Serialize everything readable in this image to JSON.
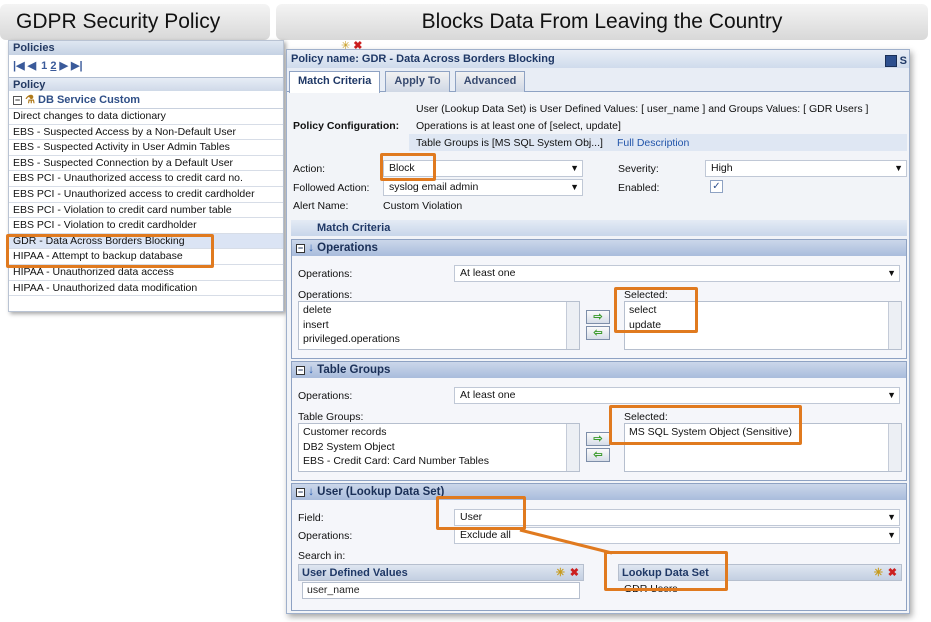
{
  "banners": {
    "left": "GDPR Security Policy",
    "right": "Blocks Data From Leaving the Country"
  },
  "left_panel": {
    "header": "Policies",
    "pager": {
      "first": "|◀",
      "prev": "◀",
      "pages": [
        "1",
        "2"
      ],
      "next": "▶",
      "last": "▶|"
    },
    "column": "Policy",
    "group": "DB Service Custom",
    "rows": [
      "Direct changes to data dictionary",
      "EBS - Suspected Access by a Non-Default User",
      "EBS - Suspected Activity in User Admin Tables",
      "EBS - Suspected Connection by a Default User",
      "EBS PCI - Unauthorized access to credit card no.",
      "EBS PCI - Unauthorized access to credit cardholder",
      "EBS PCI - Violation to credit card number table",
      "EBS PCI - Violation to credit cardholder",
      "GDR - Data Across Borders Blocking",
      "HIPAA - Attempt to backup database",
      "HIPAA - Unauthorized data access",
      "HIPAA - Unauthorized data modification"
    ]
  },
  "policy_window": {
    "title": "Policy name: GDR - Data Across Borders Blocking",
    "save_suffix": "S",
    "tabs": [
      "Match Criteria",
      "Apply To",
      "Advanced"
    ],
    "config_label": "Policy Configuration:",
    "config_lines": [
      "User (Lookup Data Set) is User Defined Values: [ user_name ] and Groups Values: [ GDR Users ]",
      "Operations is at least one of [select, update]",
      "Table Groups is [MS SQL System Obj...]"
    ],
    "full_description": "Full Description",
    "action_label": "Action:",
    "action_value": "Block",
    "severity_label": "Severity:",
    "severity_value": "High",
    "followed_label": "Followed Action:",
    "followed_value": "syslog email admin",
    "enabled_label": "Enabled:",
    "enabled_check": "✓",
    "alert_label": "Alert Name:",
    "alert_value": "Custom Violation",
    "match_criteria_header": "Match Criteria",
    "operations_section": {
      "title": "Operations",
      "ops_label": "Operations:",
      "ops_value": "At least one",
      "list_label": "Operations:",
      "available": [
        "delete",
        "insert",
        "privileged.operations"
      ],
      "selected_label": "Selected:",
      "selected": [
        "select",
        "update"
      ]
    },
    "table_groups_section": {
      "title": "Table Groups",
      "ops_label": "Operations:",
      "ops_value": "At least one",
      "list_label": "Table Groups:",
      "available": [
        "Customer records",
        "DB2 System Object",
        "EBS - Credit Card: Card Number Tables"
      ],
      "selected_label": "Selected:",
      "selected": [
        "MS SQL System Object (Sensitive)"
      ]
    },
    "user_section": {
      "title": "User (Lookup Data Set)",
      "field_label": "Field:",
      "field_value": "User",
      "ops_label": "Operations:",
      "ops_value": "Exclude all",
      "search_label": "Search in:",
      "udv_header": "User Defined Values",
      "udv_value": "user_name",
      "lookup_header": "Lookup Data Set",
      "lookup_value": "GDR Users"
    }
  },
  "colors": {
    "highlight": "#e07a1f",
    "accent": "#1f3866"
  }
}
